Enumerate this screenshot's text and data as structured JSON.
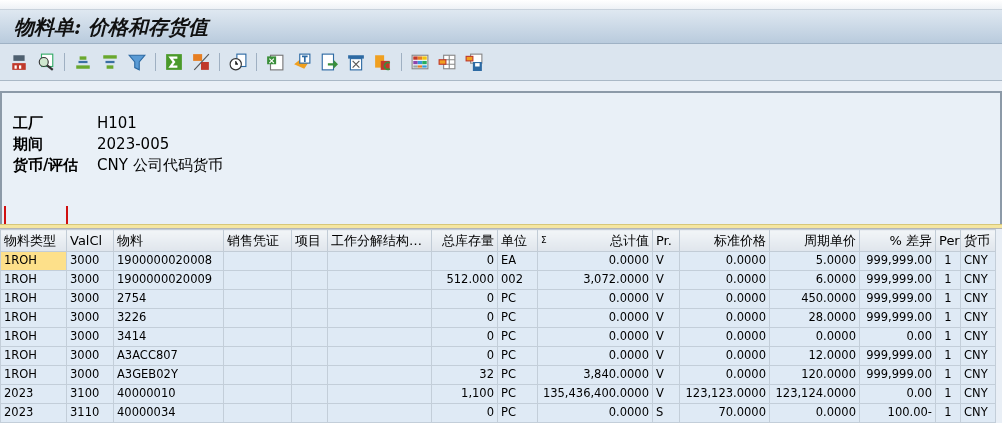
{
  "window": {
    "title": "物料单: 价格和存货值"
  },
  "header": [
    {
      "label": "工厂",
      "value": "H101"
    },
    {
      "label": "期间",
      "value": "2023-005"
    },
    {
      "label": "货币/评估",
      "value": "CNY 公司代码货币"
    }
  ],
  "table": {
    "columns": [
      {
        "label": "物料类型"
      },
      {
        "label": "ValCl"
      },
      {
        "label": "物料"
      },
      {
        "label": "销售凭证"
      },
      {
        "label": "项目"
      },
      {
        "label": "工作分解结构…"
      },
      {
        "label": "总库存量"
      },
      {
        "label": "单位"
      },
      {
        "label": "总计值",
        "marker": "Σ"
      },
      {
        "label": "Pr."
      },
      {
        "label": "标准价格"
      },
      {
        "label": "周期单价"
      },
      {
        "label": "% 差异"
      },
      {
        "label": "Per"
      },
      {
        "label": "货币"
      }
    ],
    "rows": [
      {
        "selected": true,
        "cells": [
          "1ROH",
          "3000",
          "1900000020008",
          "",
          "",
          "",
          "0",
          "EA",
          "0.0000",
          "V",
          "0.0000",
          "5.0000",
          "999,999.00",
          "1",
          "CNY"
        ]
      },
      {
        "selected": false,
        "cells": [
          "1ROH",
          "3000",
          "1900000020009",
          "",
          "",
          "",
          "512.000",
          "002",
          "3,072.0000",
          "V",
          "0.0000",
          "6.0000",
          "999,999.00",
          "1",
          "CNY"
        ]
      },
      {
        "selected": false,
        "cells": [
          "1ROH",
          "3000",
          "2754",
          "",
          "",
          "",
          "0",
          "PC",
          "0.0000",
          "V",
          "0.0000",
          "450.0000",
          "999,999.00",
          "1",
          "CNY"
        ]
      },
      {
        "selected": false,
        "cells": [
          "1ROH",
          "3000",
          "3226",
          "",
          "",
          "",
          "0",
          "PC",
          "0.0000",
          "V",
          "0.0000",
          "28.0000",
          "999,999.00",
          "1",
          "CNY"
        ]
      },
      {
        "selected": false,
        "cells": [
          "1ROH",
          "3000",
          "3414",
          "",
          "",
          "",
          "0",
          "PC",
          "0.0000",
          "V",
          "0.0000",
          "0.0000",
          "0.00",
          "1",
          "CNY"
        ]
      },
      {
        "selected": false,
        "cells": [
          "1ROH",
          "3000",
          "A3ACC807",
          "",
          "",
          "",
          "0",
          "PC",
          "0.0000",
          "V",
          "0.0000",
          "12.0000",
          "999,999.00",
          "1",
          "CNY"
        ]
      },
      {
        "selected": false,
        "cells": [
          "1ROH",
          "3000",
          "A3GEB02Y",
          "",
          "",
          "",
          "32",
          "PC",
          "3,840.0000",
          "V",
          "0.0000",
          "120.0000",
          "999,999.00",
          "1",
          "CNY"
        ]
      },
      {
        "selected": false,
        "cells": [
          "2023",
          "3100",
          "40000010",
          "",
          "",
          "",
          "1,100",
          "PC",
          "135,436,400.0000",
          "V",
          "123,123.0000",
          "123,124.0000",
          "0.00",
          "1",
          "CNY"
        ]
      },
      {
        "selected": false,
        "cells": [
          "2023",
          "3110",
          "40000034",
          "",
          "",
          "",
          "0",
          "PC",
          "0.0000",
          "S",
          "70.0000",
          "0.0000",
          "100.00-",
          "1",
          "CNY"
        ]
      }
    ]
  }
}
